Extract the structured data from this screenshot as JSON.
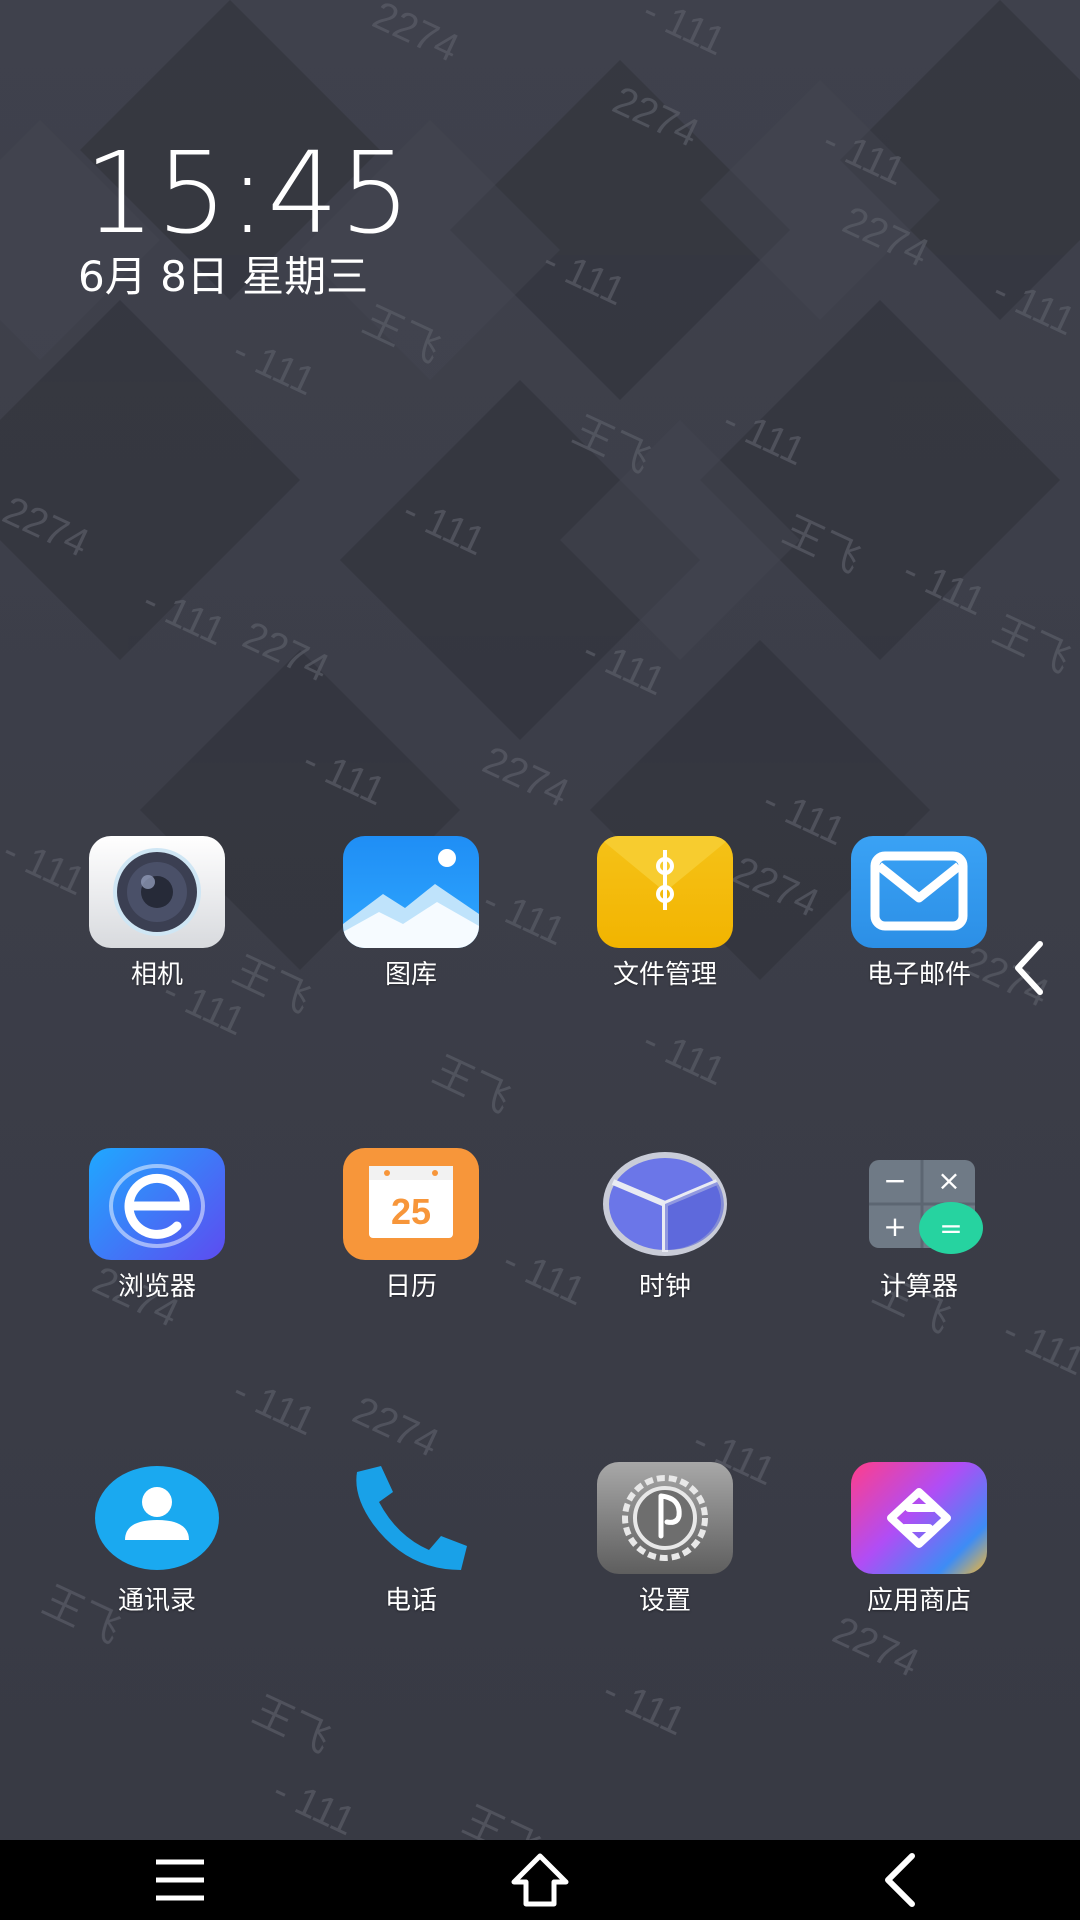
{
  "lockscreen": {
    "time": "15:45",
    "date": "6月 8日 星期三"
  },
  "apps": [
    {
      "id": "camera",
      "label": "相机",
      "icon": "camera-icon"
    },
    {
      "id": "gallery",
      "label": "图库",
      "icon": "gallery-icon"
    },
    {
      "id": "files",
      "label": "文件管理",
      "icon": "file-manager-icon"
    },
    {
      "id": "email",
      "label": "电子邮件",
      "icon": "email-icon"
    },
    {
      "id": "browser",
      "label": "浏览器",
      "icon": "browser-icon"
    },
    {
      "id": "calendar",
      "label": "日历",
      "icon": "calendar-icon",
      "day": "25"
    },
    {
      "id": "clock",
      "label": "时钟",
      "icon": "clock-icon"
    },
    {
      "id": "calculator",
      "label": "计算器",
      "icon": "calculator-icon"
    },
    {
      "id": "contacts",
      "label": "通讯录",
      "icon": "contacts-icon"
    },
    {
      "id": "phone",
      "label": "电话",
      "icon": "phone-icon"
    },
    {
      "id": "settings",
      "label": "设置",
      "icon": "settings-icon"
    },
    {
      "id": "appstore",
      "label": "应用商店",
      "icon": "app-store-icon"
    }
  ],
  "calculator_symbols": {
    "minus": "−",
    "times": "×",
    "plus": "+",
    "equals": "="
  },
  "watermark": {
    "name": "王飞",
    "code": "2274",
    "suffix": "- 111"
  },
  "navbar": {
    "menu_icon": "menu-icon",
    "home_icon": "home-icon",
    "back_icon": "back-icon"
  },
  "edge_panel": {
    "icon": "chevron-left-icon"
  },
  "colors": {
    "wallpaper": "#3a3c46",
    "navbar": "#000000"
  }
}
